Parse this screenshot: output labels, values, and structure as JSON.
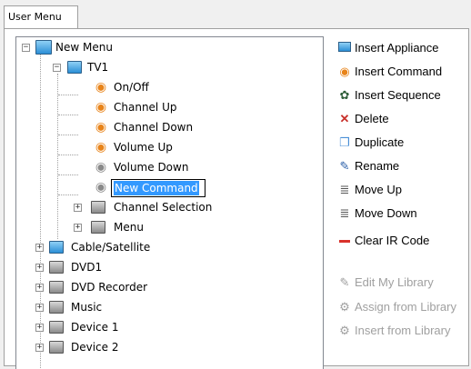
{
  "tab": {
    "label": "User Menu"
  },
  "tree": {
    "root": "New Menu",
    "tv1": "TV1",
    "commands": [
      "On/Off",
      "Channel Up",
      "Channel Down",
      "Volume Up",
      "Volume Down"
    ],
    "editing": "New Command",
    "sub": [
      "Channel Selection",
      "Menu"
    ],
    "devices": [
      "Cable/Satellite",
      "DVD1",
      "DVD Recorder",
      "Music",
      "Device 1",
      "Device 2"
    ]
  },
  "actions": {
    "insert_appliance": "Insert Appliance",
    "insert_command": "Insert Command",
    "insert_sequence": "Insert Sequence",
    "delete": "Delete",
    "duplicate": "Duplicate",
    "rename": "Rename",
    "move_up": "Move Up",
    "move_down": "Move Down",
    "clear_ir": "Clear IR Code",
    "edit_library": "Edit My Library",
    "assign_library": "Assign from Library",
    "insert_library": "Insert from Library"
  },
  "icons": {
    "appliance": "tv-icon",
    "command": "signal-icon",
    "sequence": "sequence-icon",
    "delete": "delete-icon",
    "duplicate": "duplicate-icon",
    "rename": "rename-icon",
    "move_up": "move-up-icon",
    "move_down": "move-down-icon",
    "clear": "clear-icon"
  },
  "colors": {
    "selection": "#3399ff",
    "command_orange": "#e8841a",
    "command_gray": "#8a8a8a",
    "delete_red": "#c8302a",
    "clear_red": "#d9322b"
  }
}
